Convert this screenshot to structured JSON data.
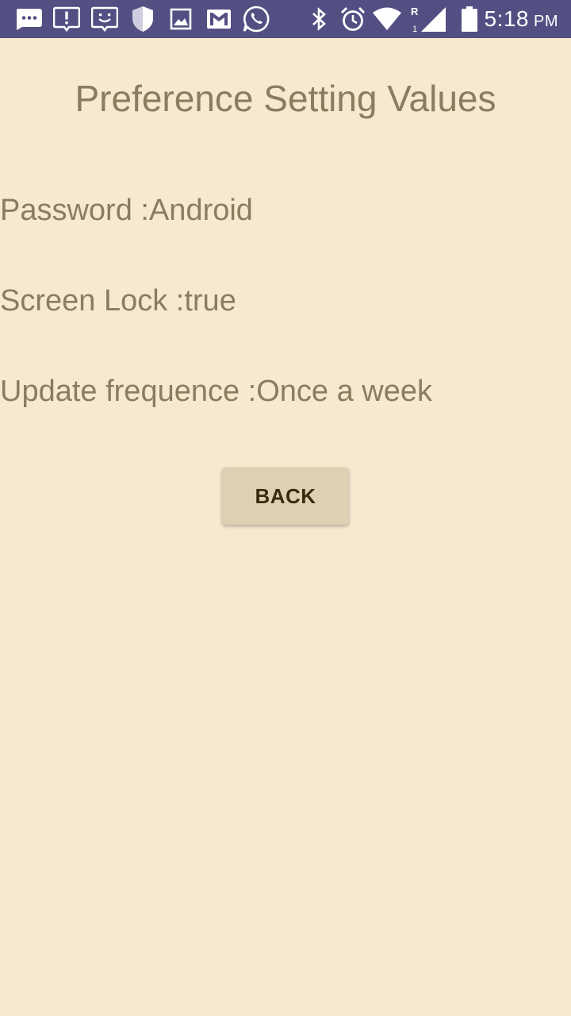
{
  "status_bar": {
    "time": "5:18",
    "ampm": "PM",
    "signal_roaming": "R",
    "signal_sim": "1",
    "icons": [
      "chat-more-icon",
      "alert-message-icon",
      "feedback-icon",
      "shield-icon",
      "image-icon",
      "gmail-icon",
      "whatsapp-icon",
      "bluetooth-icon",
      "alarm-icon",
      "wifi-icon",
      "cell-signal-icon",
      "battery-icon"
    ]
  },
  "page": {
    "title": "Preference Setting Values",
    "lines": [
      "Password :Android",
      "Screen Lock :true",
      "Update frequence :Once a week"
    ],
    "back_label": "BACK"
  },
  "colors": {
    "status_bar_bg": "#544f83",
    "background": "#f7e9d0",
    "text": "#8a7c5f",
    "button_bg": "#ddd1b4",
    "button_text": "#3a2c0c"
  }
}
